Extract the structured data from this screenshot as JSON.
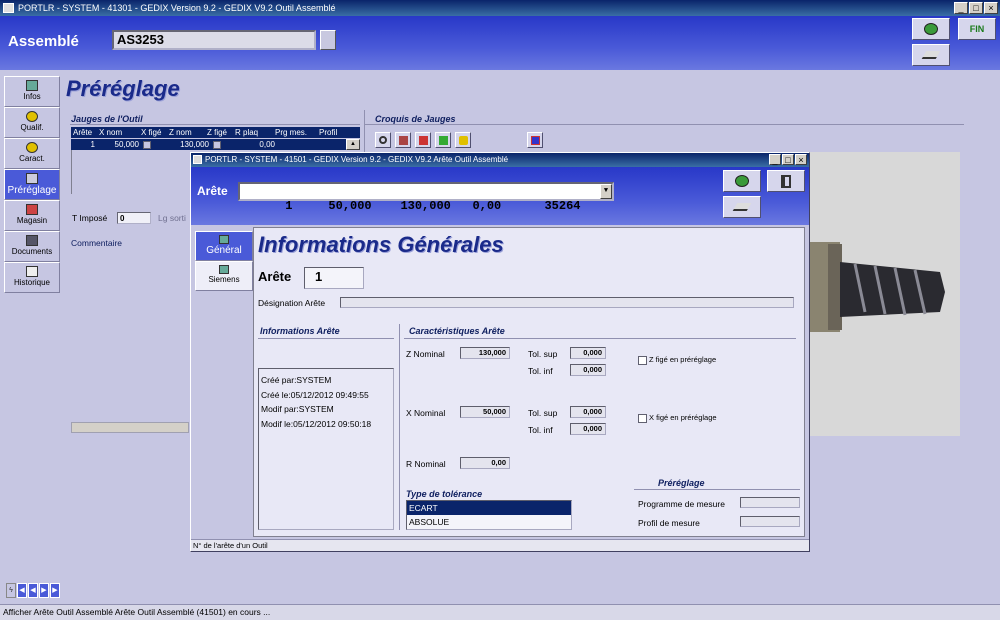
{
  "window": {
    "title": "PORTLR - SYSTEM - 41301 - GEDIX Version 9.2 - GEDIX V9.2 Outil Assemblé"
  },
  "header": {
    "label": "Assemblé",
    "assembly_value": "AS3253",
    "fin_label": "FIN"
  },
  "sidebar": {
    "items": [
      {
        "label": "Infos"
      },
      {
        "label": "Qualif."
      },
      {
        "label": "Caract."
      },
      {
        "label": "Préréglage"
      },
      {
        "label": "Magasin"
      },
      {
        "label": "Documents"
      },
      {
        "label": "Historique"
      }
    ],
    "active_index": 3
  },
  "page": {
    "title": "Préréglage"
  },
  "gauges": {
    "title": "Jauges de l'Outil",
    "columns": [
      "Arête",
      "X nom",
      "X figé",
      "Z nom",
      "Z figé",
      "R plaq",
      "Prg mes.",
      "Profil"
    ],
    "rows": [
      {
        "arete": "1",
        "xnom": "50,000",
        "znom": "130,000",
        "rplaq": "0,00"
      }
    ]
  },
  "croquis": {
    "title": "Croquis de Jauges"
  },
  "bg_fields": {
    "t_impose_label": "T Imposé",
    "t_impose_value": "0",
    "lg_sortie_label": "Lg sorti",
    "commentaire_label": "Commentaire"
  },
  "dialog": {
    "title": "PORTLR - SYSTEM - 41501 - GEDIX Version 9.2 - GEDIX V9.2 Arête Outil Assemblé",
    "arete_label": "Arête",
    "combo_value": "1     50,000    130,000   0,00      35264",
    "tabs": [
      {
        "label": "Général"
      },
      {
        "label": "Siemens"
      }
    ],
    "heading": "Informations Générales",
    "arete_field_label": "Arête",
    "arete_field_value": "1",
    "designation_label": "Désignation Arête",
    "info_section_title": "Informations Arête",
    "info_lines": [
      "Créé par:SYSTEM",
      "Créé le:05/12/2012 09:49:55",
      "Modif par:SYSTEM",
      "Modif le:05/12/2012 09:50:18"
    ],
    "carac_title": "Caractéristiques Arête",
    "z_nominal_label": "Z Nominal",
    "z_nominal_value": "130,000",
    "z_tol_sup_label": "Tol. sup",
    "z_tol_sup_value": "0,000",
    "z_tol_inf_label": "Tol. inf",
    "z_tol_inf_value": "0,000",
    "z_fige_label": "Z figé en préréglage",
    "x_nominal_label": "X Nominal",
    "x_nominal_value": "50,000",
    "x_tol_sup_label": "Tol. sup",
    "x_tol_sup_value": "0,000",
    "x_tol_inf_label": "Tol. inf",
    "x_tol_inf_value": "0,000",
    "x_fige_label": "X figé en préréglage",
    "r_nominal_label": "R Nominal",
    "r_nominal_value": "0,00",
    "tolerance_title": "Type de tolérance",
    "tolerance_options": [
      "ECART",
      "ABSOLUE"
    ],
    "tolerance_selected": 0,
    "prereglage_title": "Préréglage",
    "programme_label": "Programme de mesure",
    "profil_label": "Profil de mesure",
    "status": "N° de l'arête d'un Outil"
  },
  "statusbar": {
    "text": "Afficher Arête Outil Assemblé Arête Outil Assemblé (41501) en cours ..."
  },
  "colors": {
    "header_blue": "#3a48d0",
    "selection_navy": "#0a246a",
    "background": "#c6c6e2"
  }
}
